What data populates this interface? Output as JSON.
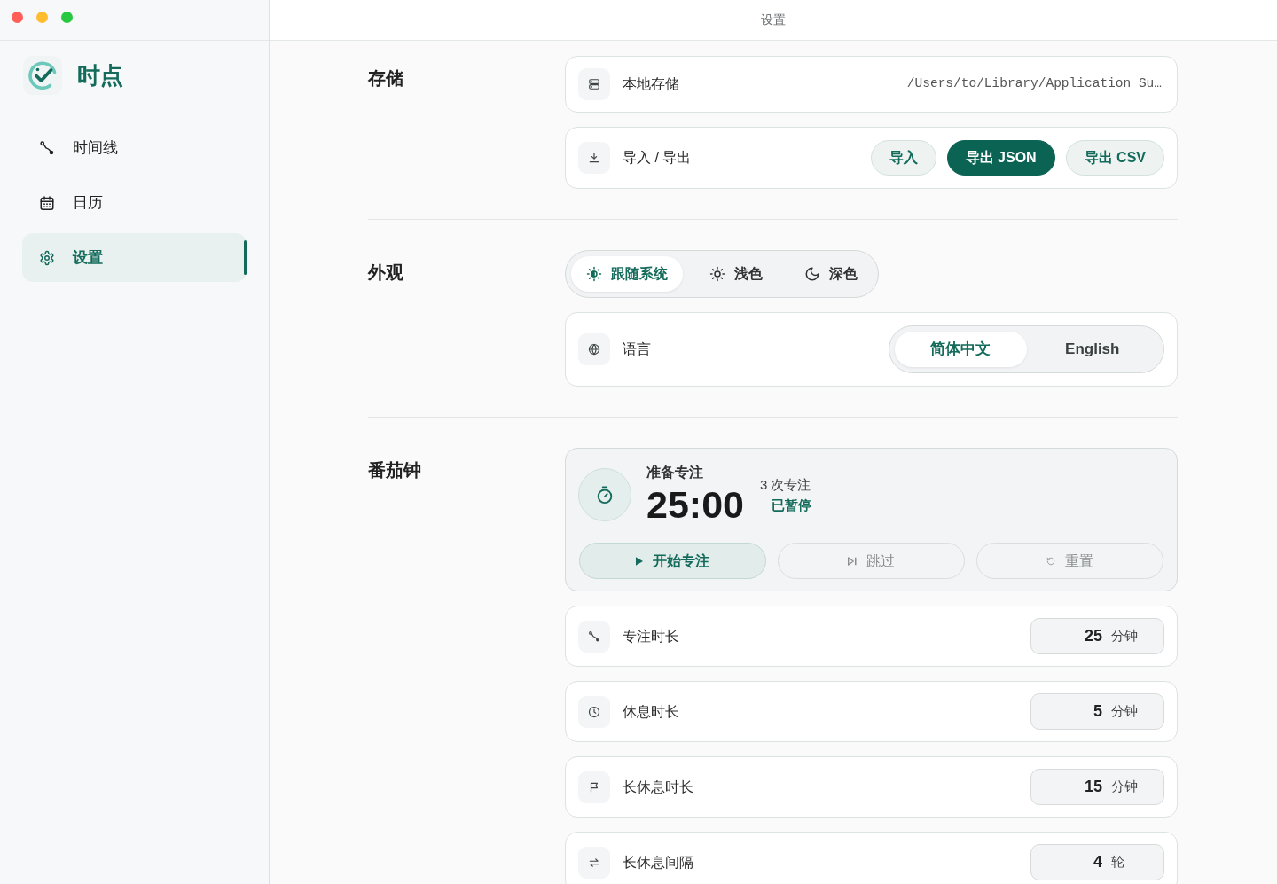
{
  "window": {
    "title": "设置"
  },
  "sidebar": {
    "app_name": "时点",
    "items": [
      {
        "label": "时间线",
        "selected": false
      },
      {
        "label": "日历",
        "selected": false
      },
      {
        "label": "设置",
        "selected": true
      }
    ]
  },
  "storage": {
    "title": "存储",
    "local_storage": {
      "label": "本地存储",
      "value": "/Users/to/Library/Application Su…"
    },
    "import_export": {
      "label": "导入 / 导出",
      "buttons": [
        {
          "label": "导入",
          "primary": false
        },
        {
          "label": "导出 JSON",
          "primary": true
        },
        {
          "label": "导出 CSV",
          "primary": false
        }
      ]
    }
  },
  "appearance": {
    "title": "外观",
    "theme_options": [
      {
        "label": "跟随系统",
        "selected": true
      },
      {
        "label": "浅色",
        "selected": false
      },
      {
        "label": "深色",
        "selected": false
      }
    ],
    "language": {
      "label": "语言",
      "options": [
        {
          "label": "简体中文",
          "selected": true
        },
        {
          "label": "English",
          "selected": false
        }
      ]
    }
  },
  "pomodoro": {
    "title": "番茄钟",
    "timer": {
      "phase": "准备专注",
      "time": "25:00",
      "sessions": "3 次专注",
      "status": "已暂停"
    },
    "controls": [
      {
        "label": "开始专注",
        "disabled": false
      },
      {
        "label": "跳过",
        "disabled": true
      },
      {
        "label": "重置",
        "disabled": true
      }
    ],
    "settings": [
      {
        "label": "专注时长",
        "value": "25",
        "unit": "分钟"
      },
      {
        "label": "休息时长",
        "value": "5",
        "unit": "分钟"
      },
      {
        "label": "长休息时长",
        "value": "15",
        "unit": "分钟"
      },
      {
        "label": "长休息间隔",
        "value": "4",
        "unit": "轮"
      }
    ]
  }
}
